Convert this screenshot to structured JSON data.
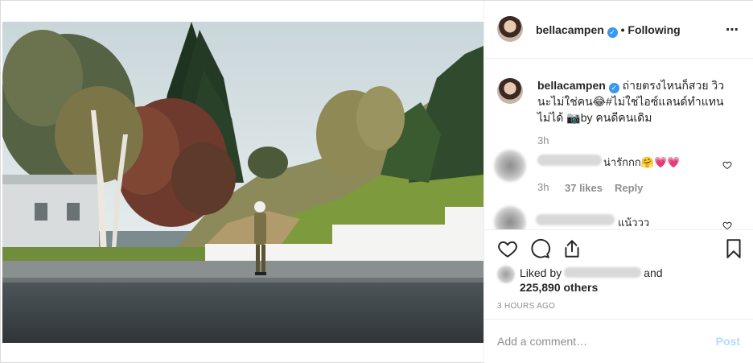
{
  "post": {
    "author": "bellacampen",
    "dot": "•",
    "follow_status": "Following",
    "more_icon": "⋯",
    "caption": "ถ่ายตรงไหนก็สวย วิวนะไม่ใช่คน😂#ไม่ใช่ไอซ์แลนด์ทำแทนไม่ได้ 📷by คนดีคนเดิม",
    "caption_age": "3h",
    "comments": [
      {
        "text": "น่ารักกก🤗💗💗",
        "age": "3h",
        "likes": "37 likes",
        "reply": "Reply"
      },
      {
        "text": "แน้ววว"
      }
    ],
    "liked_by_prefix": "Liked by",
    "liked_by_and": "and",
    "liked_by_count": "225,890 others",
    "posted_time": "3 HOURS AGO",
    "comment_placeholder": "Add a comment…",
    "post_button": "Post"
  },
  "colors": {
    "verified": "#3897f0",
    "post_disabled": "#b3dbff",
    "muted": "#8e8e8e",
    "text": "#262626"
  }
}
